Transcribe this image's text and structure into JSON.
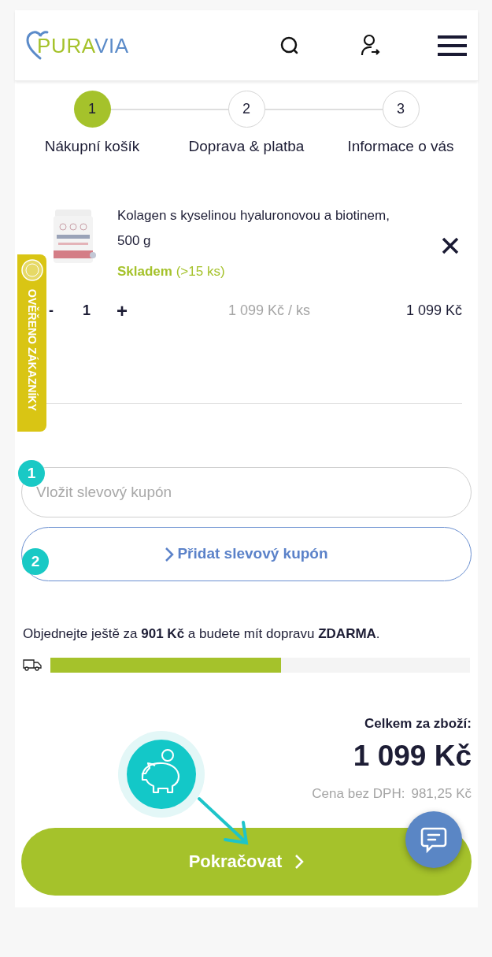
{
  "header": {
    "logo": [
      "PURA",
      "VIA"
    ]
  },
  "steps": [
    {
      "number": "1",
      "label": "Nákupní košík",
      "selected": true
    },
    {
      "number": "2",
      "label": "Doprava & platba",
      "selected": false
    },
    {
      "number": "3",
      "label": "Informace o vás",
      "selected": false
    }
  ],
  "cart_items": [
    {
      "name": "Kolagen s kyselinou hyaluronovou a biotinem, 500 g",
      "stock": "**Skladem** (>15 ks)",
      "decrement": "-",
      "quantity": "1",
      "increment": "+",
      "unit_price": "1 099 Kč / ks",
      "total": "1 099 Kč"
    }
  ],
  "verified_badge": {
    "label": "OVĚŘENO ZÁKAZNÍKY"
  },
  "coupon": {
    "placeholder": "Vložit slevový kupón",
    "add_button": "Přidat slevový kupón"
  },
  "annotations": [
    "1",
    "2"
  ],
  "shipping": {
    "message": "Objednejte ještě za **901 Kč** a budete mít dopravu **ZDARMA**.",
    "level": 0.55
  },
  "totals": {
    "label": "Celkem za zboží:",
    "total": "1 099 Kč",
    "net_label": "Cena bez DPH:",
    "net_value": "981,25 Kč"
  },
  "continue_button": "Pokračovat"
}
